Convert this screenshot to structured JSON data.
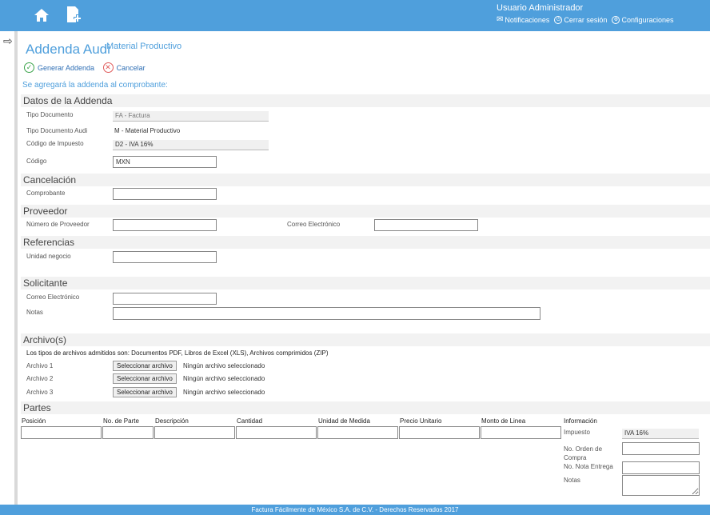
{
  "header": {
    "user": "Usuario Administrador",
    "notifications": "Notificaciones",
    "logout": "Cerrar sesión",
    "settings": "Configuraciones"
  },
  "page": {
    "title": "Addenda Audi",
    "subtitle": "Material Productivo",
    "generate": "Generar Addenda",
    "cancel": "Cancelar",
    "intro": "Se agregará la addenda al comprobante:"
  },
  "datos": {
    "section": "Datos de la Addenda",
    "tipo_documento_label": "Tipo Documento",
    "tipo_documento_value": "FA - Factura",
    "tipo_audi_label": "Tipo Documento Audi",
    "tipo_audi_value": "M - Material Productivo",
    "impuesto_label": "Código de Impuesto",
    "impuesto_value": "D2 - IVA 16%",
    "codigo_label": "Código",
    "codigo_value": "MXN"
  },
  "cancelacion": {
    "section": "Cancelación",
    "comprobante_label": "Comprobante"
  },
  "proveedor": {
    "section": "Proveedor",
    "numero_label": "Número de Proveedor",
    "correo_label": "Correo Electrónico"
  },
  "referencias": {
    "section": "Referencias",
    "unidad_label": "Unidad negocio"
  },
  "solicitante": {
    "section": "Solicitante",
    "correo_label": "Correo Electrónico",
    "notas_label": "Notas"
  },
  "archivos": {
    "section": "Archivo(s)",
    "note": "Los tipos de archivos admitidos son: Documentos PDF, Libros de Excel (XLS), Archivos comprimidos (ZIP)",
    "button": "Seleccionar archivo",
    "none": "Ningún archivo seleccionado",
    "labels": [
      "Archivo 1",
      "Archivo 2",
      "Archivo 3"
    ]
  },
  "partes": {
    "section": "Partes",
    "columns": [
      "Posición",
      "No. de Parte",
      "Descripción",
      "Cantidad",
      "Unidad de Medida",
      "Precio Unitario",
      "Monto de Linea",
      "Información"
    ],
    "impuesto_label": "Impuesto",
    "impuesto_value": "IVA 16%",
    "orden_label": "No. Orden de Compra",
    "nota_label": "No. Nota Entrega",
    "notas_label": "Notas"
  },
  "footer": "Factura Fácilmente de México S.A. de C.V. - Derechos Reservados 2017"
}
